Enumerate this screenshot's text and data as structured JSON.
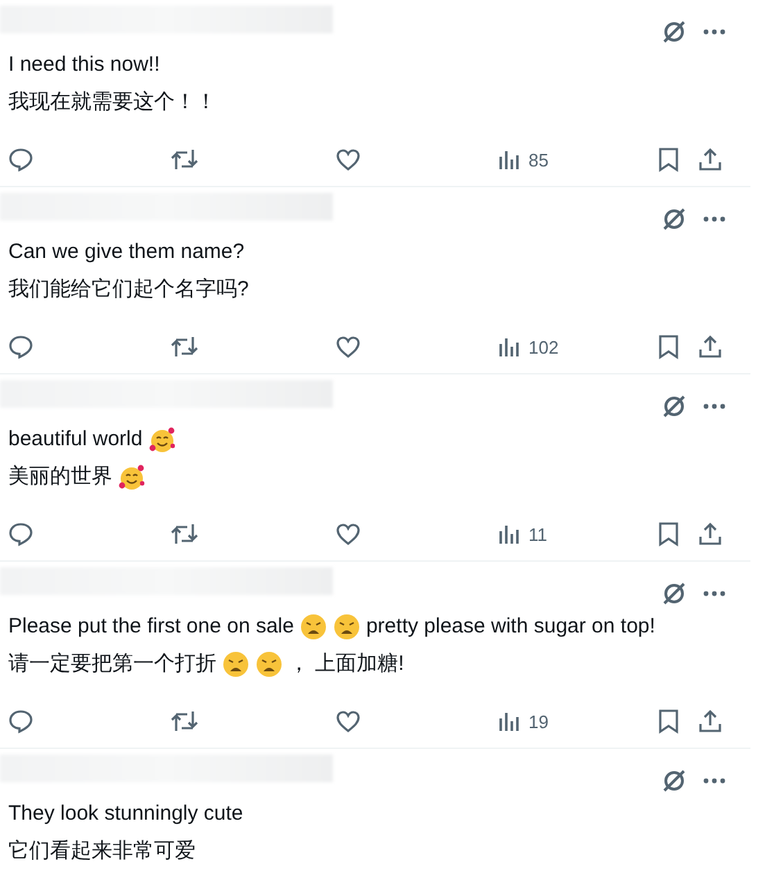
{
  "replies": [
    {
      "lines": [
        [
          {
            "kind": "text",
            "text": "I need this now!!"
          }
        ],
        [
          {
            "kind": "text",
            "text": "我现在就需要这个！！"
          }
        ]
      ],
      "views": "85"
    },
    {
      "lines": [
        [
          {
            "kind": "text",
            "text": "Can we give them name?"
          }
        ],
        [
          {
            "kind": "text",
            "text": "我们能给它们起个名字吗?"
          }
        ]
      ],
      "views": "102"
    },
    {
      "lines": [
        [
          {
            "kind": "text",
            "text": "beautiful world"
          },
          {
            "kind": "hearts-face"
          }
        ],
        [
          {
            "kind": "text",
            "text": "美丽的世界"
          },
          {
            "kind": "hearts-face"
          }
        ]
      ],
      "views": "11"
    },
    {
      "lines": [
        [
          {
            "kind": "text",
            "text": "Please put the first one on sale"
          },
          {
            "kind": "weary-face"
          },
          {
            "kind": "weary-face"
          },
          {
            "kind": "text",
            "text": "pretty please with sugar on top!"
          }
        ],
        [
          {
            "kind": "text",
            "text": "请一定要把第一个打折"
          },
          {
            "kind": "weary-face"
          },
          {
            "kind": "weary-face"
          },
          {
            "kind": "text",
            "text": "， 上面加糖!"
          }
        ]
      ],
      "views": "19"
    },
    {
      "lines": [
        [
          {
            "kind": "text",
            "text": "They look stunningly cute"
          }
        ],
        [
          {
            "kind": "text",
            "text": "它们看起来非常可爱"
          }
        ]
      ]
    }
  ]
}
